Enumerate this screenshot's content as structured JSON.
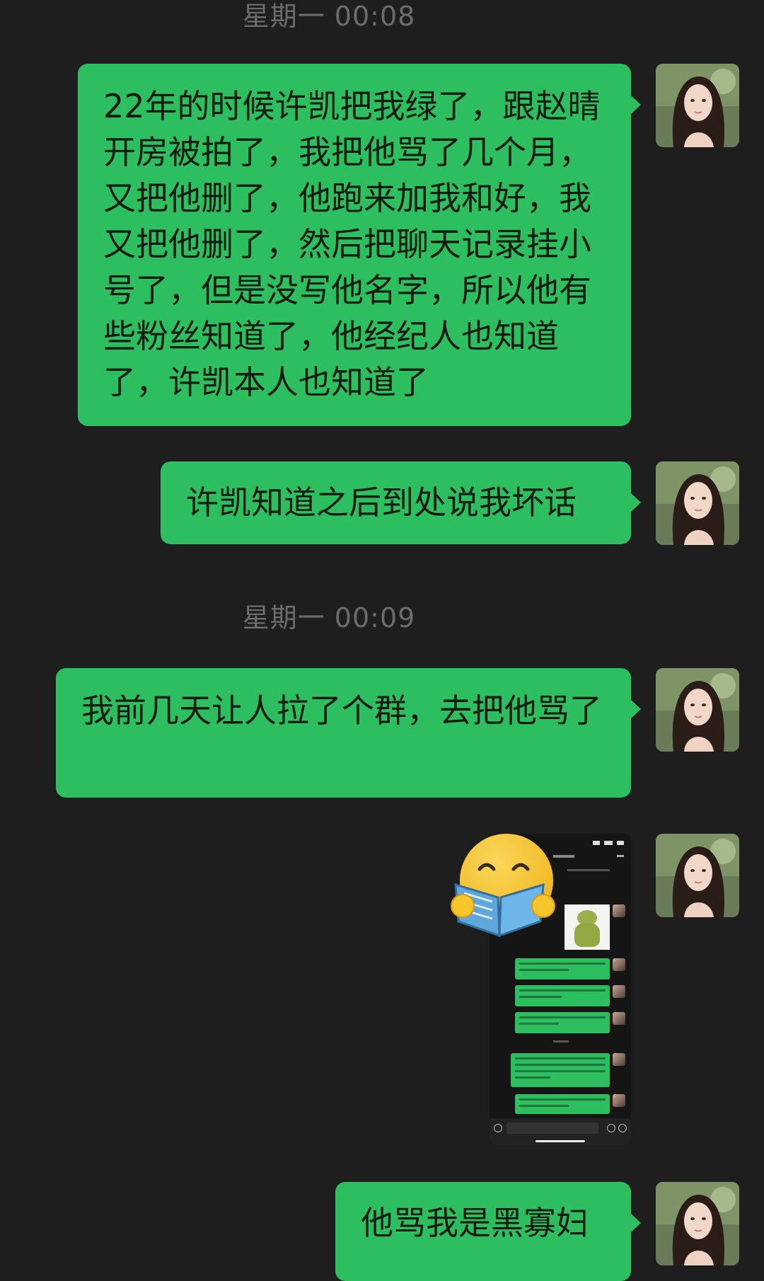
{
  "timestamps": [
    {
      "text": "星期一 00:08"
    },
    {
      "text": "星期一 00:09"
    }
  ],
  "messages": [
    {
      "text": "22年的时候许凯把我绿了，跟赵晴开房被拍了，我把他骂了几个月，又把他删了，他跑来加我和好，我又把他删了，然后把聊天记录挂小号了，但是没写他名字，所以他有些粉丝知道了，他经纪人也知道了，许凯本人也知道了"
    },
    {
      "text": "许凯知道之后到处说我坏话"
    },
    {
      "text": "我前几天让人拉了个群，去把他骂了"
    },
    {
      "text": "他骂我是黑寡妇"
    }
  ],
  "colors": {
    "background": "#1e1e1e",
    "bubble": "#2dbf5f",
    "timestamp": "#6c6c6c"
  },
  "icons": {
    "sticker": "smiley-reading-book-icon",
    "avatar": "user-avatar-photo"
  }
}
